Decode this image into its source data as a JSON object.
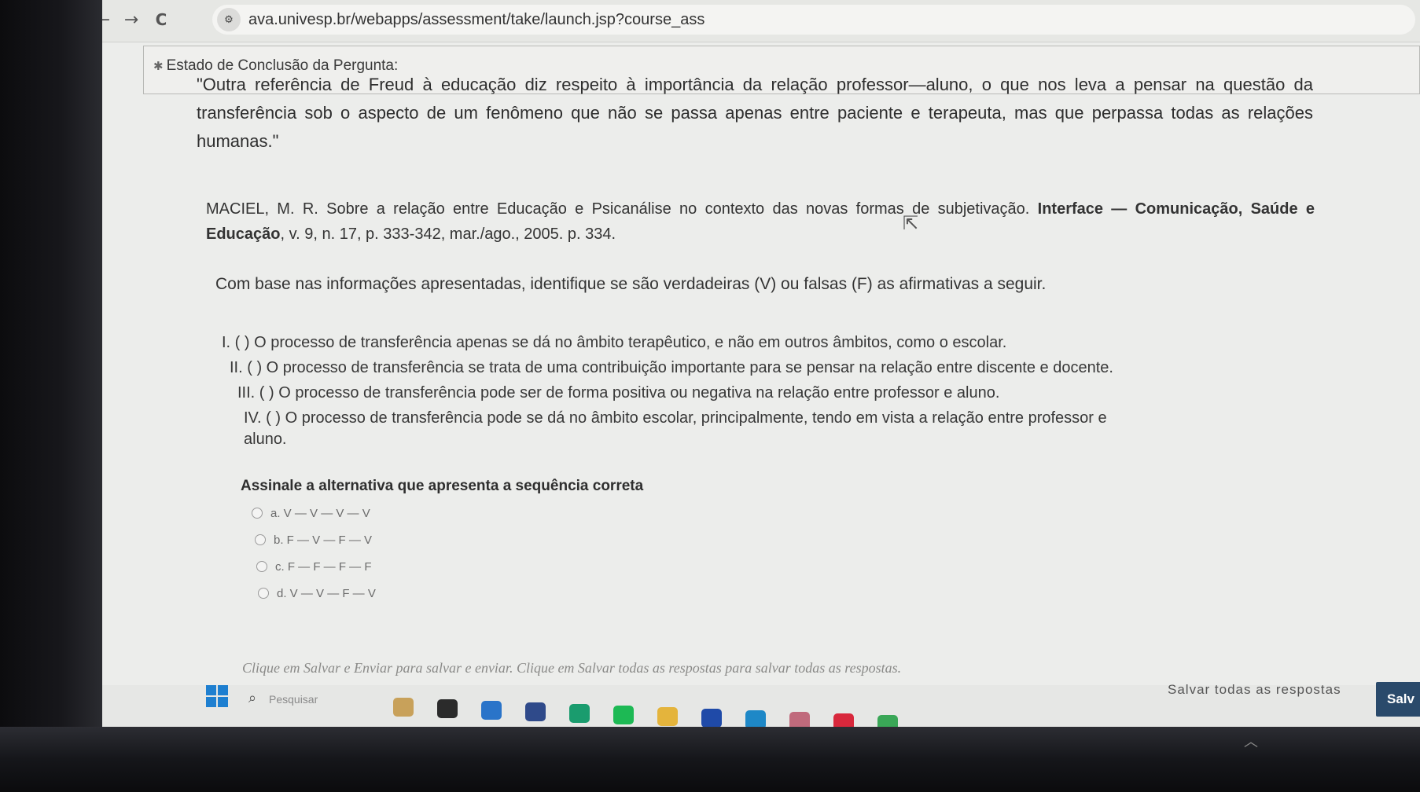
{
  "browser": {
    "back_icon": "←",
    "forward_icon": "→",
    "reload_icon": "C",
    "site_info_icon": "⚙",
    "url": "ava.univesp.br/webapps/assessment/take/launch.jsp?course_ass"
  },
  "question": {
    "status_label": "Estado de Conclusão da Pergunta:",
    "quote": "\"Outra referência de Freud à educação diz respeito à importância da relação professor—aluno, o que nos leva a pensar na questão da transferência sob o aspecto de um fenômeno que não se passa apenas entre paciente e terapeuta, mas que perpassa todas as relações humanas.\"",
    "ref_part1": "MACIEL, M. R. Sobre a relação entre Educação e Psicanálise no contexto das novas formas de subjetivação. ",
    "ref_bold": "Interface — Comunicação, Saúde e Educação",
    "ref_part2": ", v. 9, n. 17, p. 333-342, mar./ago., 2005. p. 334.",
    "instruction": "Com base nas informações apresentadas, identifique se são verdadeiras (V) ou falsas (F) as afirmativas a seguir.",
    "statements": [
      "I. ( ) O processo de transferência apenas se dá no âmbito terapêutico, e não em outros âmbitos, como o escolar.",
      "II. ( ) O processo de transferência se trata de uma contribuição importante para se pensar na relação entre discente e docente.",
      "III. ( ) O processo de transferência pode ser de forma positiva ou negativa na relação entre professor e aluno.",
      "IV. ( ) O processo de transferência pode se dá no âmbito escolar, principalmente, tendo em vista a relação entre professor e",
      "aluno."
    ],
    "prompt": "Assinale a alternativa que apresenta a sequência correta",
    "options": [
      "a. V — V — V — V",
      "b. F — V — F — V",
      "c. F — F — F — F",
      "d. V — V — F — V"
    ]
  },
  "footer": {
    "note": "Clique em Salvar e Enviar para salvar e enviar. Clique em Salvar todas as respostas para salvar todas as respostas.",
    "save_all_label": "Salvar todas as respostas",
    "save_submit_label": "Salv"
  },
  "taskbar": {
    "search_placeholder": "Pesquisar",
    "apps": [
      {
        "name": "widgets-icon",
        "color": "#c8a15a"
      },
      {
        "name": "file-explorer-icon",
        "color": "#2b2b2b"
      },
      {
        "name": "store-icon",
        "color": "#2a74c9"
      },
      {
        "name": "chat-icon",
        "color": "#2f4a8a"
      },
      {
        "name": "edge-icon",
        "color": "#1a9c6e"
      },
      {
        "name": "spotify-icon",
        "color": "#1db954"
      },
      {
        "name": "folder-icon",
        "color": "#e4b43c"
      },
      {
        "name": "calendar-icon",
        "color": "#1f4aa8"
      },
      {
        "name": "photos-icon",
        "color": "#1e88c7"
      },
      {
        "name": "app-icon",
        "color": "#c06a7c"
      },
      {
        "name": "opera-icon",
        "color": "#d8283c"
      },
      {
        "name": "chrome-icon",
        "color": "#3aa757"
      }
    ]
  }
}
